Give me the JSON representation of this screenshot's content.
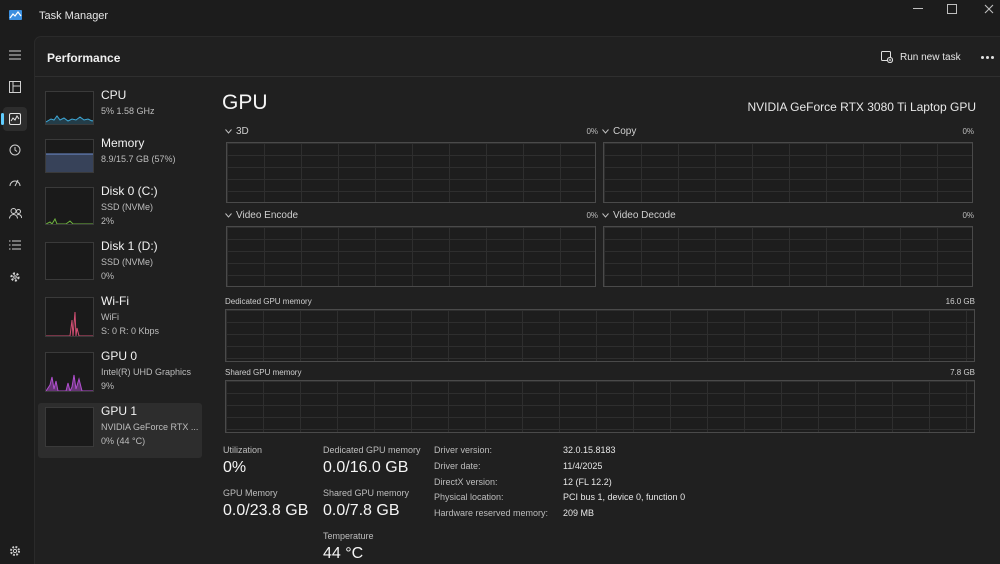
{
  "window": {
    "title": "Task Manager"
  },
  "header": {
    "title": "Performance",
    "run_new_task": "Run new task"
  },
  "colors": {
    "accent": "#60cdff",
    "cpu": "#3ea8d6",
    "memory": "#6f8fd0",
    "disk": "#6fb43f",
    "network": "#d24f73",
    "gpu": "#b14fcf"
  },
  "rail_icons": [
    "hamburger-icon",
    "processes-icon",
    "performance-icon",
    "app-history-icon",
    "startup-apps-icon",
    "users-icon",
    "details-icon",
    "services-icon",
    "settings-icon"
  ],
  "resources": [
    {
      "name": "CPU",
      "line1": "5%  1.58 GHz",
      "line2": ""
    },
    {
      "name": "Memory",
      "line1": "8.9/15.7 GB (57%)",
      "line2": ""
    },
    {
      "name": "Disk 0 (C:)",
      "line1": "SSD (NVMe)",
      "line2": "2%"
    },
    {
      "name": "Disk 1 (D:)",
      "line1": "SSD (NVMe)",
      "line2": "0%"
    },
    {
      "name": "Wi-Fi",
      "line1": "WiFi",
      "line2": "S: 0  R: 0 Kbps"
    },
    {
      "name": "GPU 0",
      "line1": "Intel(R) UHD Graphics",
      "line2": "9%"
    },
    {
      "name": "GPU 1",
      "line1": "NVIDIA GeForce RTX ...",
      "line2": "0%  (44 °C)"
    }
  ],
  "gpu": {
    "title": "GPU",
    "model": "NVIDIA GeForce RTX 3080 Ti Laptop GPU",
    "engines": [
      {
        "name": "3D",
        "percent": "0%"
      },
      {
        "name": "Copy",
        "percent": "0%"
      },
      {
        "name": "Video Encode",
        "percent": "0%"
      },
      {
        "name": "Video Decode",
        "percent": "0%"
      }
    ],
    "dedicated_memory_label": "Dedicated GPU memory",
    "dedicated_memory_max": "16.0 GB",
    "shared_memory_label": "Shared GPU memory",
    "shared_memory_max": "7.8 GB",
    "stats": {
      "utilization_label": "Utilization",
      "utilization": "0%",
      "gpu_memory_label": "GPU Memory",
      "gpu_memory": "0.0/23.8 GB",
      "dedicated_label": "Dedicated GPU memory",
      "dedicated": "0.0/16.0 GB",
      "shared_label": "Shared GPU memory",
      "shared": "0.0/7.8 GB",
      "temperature_label": "Temperature",
      "temperature": "44 °C"
    },
    "info": [
      {
        "label": "Driver version:",
        "value": "32.0.15.8183"
      },
      {
        "label": "Driver date:",
        "value": "11/4/2025"
      },
      {
        "label": "DirectX version:",
        "value": "12 (FL 12.2)"
      },
      {
        "label": "Physical location:",
        "value": "PCI bus 1, device 0, function 0"
      },
      {
        "label": "Hardware reserved memory:",
        "value": "209 MB"
      }
    ]
  }
}
